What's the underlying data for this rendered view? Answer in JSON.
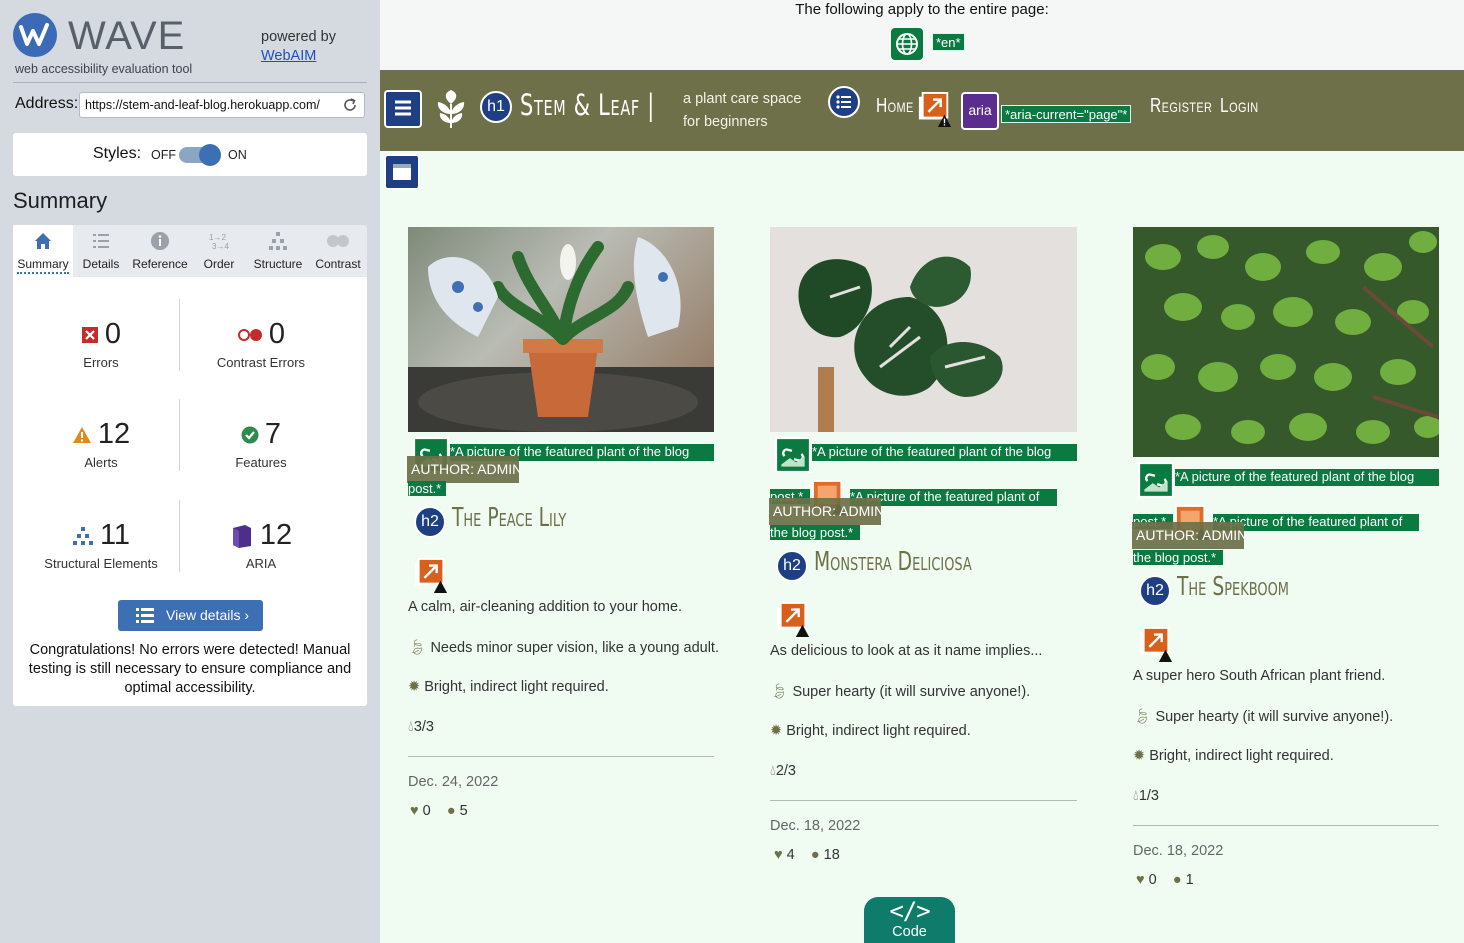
{
  "wave": {
    "title": "WAVE",
    "subtitle": "web accessibility evaluation tool",
    "powered_by": "powered by",
    "webaim": "WebAIM",
    "address_label": "Address:",
    "address_value": "https://stem-and-leaf-blog.herokuapp.com/",
    "styles_label": "Styles:",
    "styles_off": "OFF",
    "styles_on": "ON",
    "summary_heading": "Summary",
    "tabs": [
      {
        "label": "Summary",
        "icon": "home-icon"
      },
      {
        "label": "Details",
        "icon": "list-icon"
      },
      {
        "label": "Reference",
        "icon": "info-icon"
      },
      {
        "label": "Order",
        "icon": "order-icon"
      },
      {
        "label": "Structure",
        "icon": "structure-icon"
      },
      {
        "label": "Contrast",
        "icon": "contrast-icon"
      }
    ],
    "stats": {
      "errors": {
        "value": "0",
        "label": "Errors"
      },
      "contrast": {
        "value": "0",
        "label": "Contrast Errors"
      },
      "alerts": {
        "value": "12",
        "label": "Alerts"
      },
      "features": {
        "value": "7",
        "label": "Features"
      },
      "structural": {
        "value": "11",
        "label": "Structural Elements"
      },
      "aria": {
        "value": "12",
        "label": "ARIA"
      }
    },
    "view_details": "View details ›",
    "congrats": "Congratulations! No errors were detected! Manual testing is still necessary to ensure compliance and optimal accessibility.",
    "colors": {
      "accent": "#3d6fb5",
      "error": "#c62a2a",
      "alert": "#e08a1e",
      "feature": "#2e8a4d",
      "aria": "#4b2f8a"
    }
  },
  "page": {
    "note": "The following apply to the entire page:",
    "lang_tag": "*en*",
    "brand": "Stem & Leaf |",
    "tagline_1": "a plant care space",
    "tagline_2": "for beginners",
    "nav_home": "Home",
    "aria_label": "aria",
    "aria_current": "*aria-current=\"page\"*",
    "nav_register": "Register",
    "nav_login": "Login",
    "h1_badge": "h1",
    "h2_badge": "h2",
    "code_label": "Code",
    "colors": {
      "nav": "#6d7048",
      "bg": "#f0fbf2",
      "tag": "#0a7a41"
    }
  },
  "posts": [
    {
      "alt": "*A picture of the featured plant of the blog post.*",
      "author": "AUTHOR: ADMIN",
      "title": "The Peace Lily",
      "excerpt": "A calm, air-cleaning addition to your home.",
      "care": "Needs minor super vision, like a young adult.",
      "light": "Bright, indirect light required.",
      "water": "3/3",
      "date": "Dec. 24, 2022",
      "likes": "0",
      "comments": "5"
    },
    {
      "alt": "*A picture of the featured plant of the blog post.*",
      "alt2": "*A picture of the featured plant of the blog post.*",
      "author": "AUTHOR: ADMIN",
      "title": "Monstera Deliciosa",
      "excerpt": "As delicious to look at as it name implies...",
      "care": "Super hearty (it will survive anyone!).",
      "light": "Bright, indirect light required.",
      "water": "2/3",
      "date": "Dec. 18, 2022",
      "likes": "4",
      "comments": "18"
    },
    {
      "alt": "*A picture of the featured plant of the blog post.*",
      "alt2": "*A picture of the featured plant of the blog post.*",
      "author": "AUTHOR: ADMIN",
      "title": "The Spekboom",
      "excerpt": "A super hero South African plant friend.",
      "care": "Super hearty (it will survive anyone!).",
      "light": "Bright, indirect light required.",
      "water": "1/3",
      "date": "Dec. 18, 2022",
      "likes": "0",
      "comments": "1"
    }
  ]
}
